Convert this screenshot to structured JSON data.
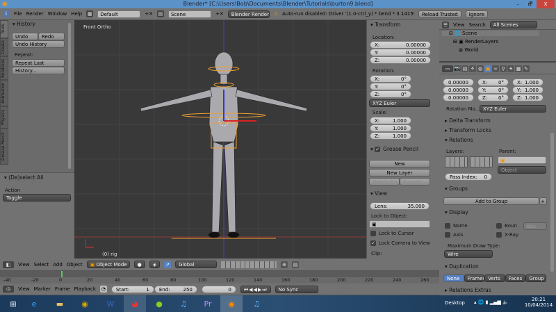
{
  "window": {
    "title": "Blender* [C:\\Users\\Bob\\Documents\\Blender\\Tutorials\\burton9.blend]",
    "minimize": "–",
    "maximize": "🗗",
    "close": "X"
  },
  "info_header": {
    "menus": [
      "File",
      "Render",
      "Window",
      "Help"
    ],
    "layout": "Default",
    "scene": "Scene",
    "engine": "Blender Render",
    "warning": "Auto-run disabled: Driver '(1.0-ctrl_y) * bend * 3.14159 * 2'",
    "reload": "Reload Trusted",
    "ignore": "Ignore"
  },
  "tool_shelf": {
    "tabs": [
      "Tools",
      "Create",
      "Relations",
      "Animation",
      "Physics",
      "Grease Pencil"
    ],
    "history_title": "History",
    "undo": "Undo",
    "redo": "Redo",
    "undo_history": "Undo History",
    "repeat_label": "Repeat:",
    "repeat_last": "Repeat Last",
    "history": "History...",
    "operator_title": "(De)select All",
    "action_label": "Action",
    "action_value": "Toggle"
  },
  "viewport": {
    "view_name": "Front Ortho",
    "object_label": "(0) rig"
  },
  "n_panel": {
    "transform_title": "Transform",
    "location_label": "Location:",
    "location": [
      "0.00000",
      "0.00000",
      "0.00000"
    ],
    "rotation_label": "Rotation:",
    "rotation": [
      "0°",
      "0°",
      "0°"
    ],
    "rotation_mode": "XYZ Euler",
    "scale_label": "Scale:",
    "scale": [
      "1.000",
      "1.000",
      "1.000"
    ],
    "axes": [
      "X:",
      "Y:",
      "Z:"
    ],
    "grease_title": "Grease Pencil",
    "new": "New",
    "new_layer": "New Layer",
    "delete_frame": "Delete Fra...",
    "convert": "Convert",
    "view_title": "View",
    "lens_label": "Lens:",
    "lens_value": "35.000",
    "lock_object_label": "Lock to Object:",
    "lock_cursor": "Lock to Cursor",
    "lock_camera": "Lock Camera to View",
    "clip_label": "Clip:"
  },
  "outliner": {
    "view": "View",
    "search": "Search",
    "filter": "All Scenes",
    "items": [
      "Scene",
      "RenderLayers",
      "World"
    ]
  },
  "properties": {
    "location": [
      "0.00000",
      "0.00000",
      "0.00000"
    ],
    "rotation": [
      "0°",
      "0°",
      "0°"
    ],
    "scale": [
      "1.000",
      "1.000",
      "1.000"
    ],
    "axes": [
      "X:",
      "Y:",
      "Z:"
    ],
    "rotation_mode_label": "Rotation Mo...",
    "rotation_mode": "XYZ Euler",
    "delta": "Delta Transform",
    "locks": "Transform Locks",
    "relations": "Relations",
    "layers_label": "Layers:",
    "parent_label": "Parent:",
    "parent_type": "Object",
    "pass_index_label": "Pass Index:",
    "pass_index": "0",
    "groups": "Groups",
    "add_to_group": "Add to Group",
    "display": "Display",
    "name": "Name",
    "axis": "Axis",
    "bounds": "Boun",
    "bounds_type": "Box",
    "xray": "X-Ray",
    "max_draw_label": "Maximum Draw Type:",
    "max_draw": "Wire",
    "duplication": "Duplication",
    "dup_options": [
      "None",
      "Frames",
      "Verts",
      "Faces",
      "Group"
    ],
    "relations_extras": "Relations Extras"
  },
  "view3d_header": {
    "menus": [
      "View",
      "Select",
      "Add",
      "Object"
    ],
    "mode": "Object Mode",
    "orientation": "Global"
  },
  "timeline": {
    "ticks": [
      "-40",
      "-20",
      "0",
      "20",
      "40",
      "60",
      "80",
      "100",
      "120",
      "140",
      "160",
      "180",
      "200",
      "220",
      "240",
      "260"
    ],
    "menus": [
      "View",
      "Marker",
      "Frame",
      "Playback"
    ],
    "start_label": "Start:",
    "start": "1",
    "end_label": "End:",
    "end": "250",
    "current": "0",
    "sync": "No Sync"
  },
  "taskbar": {
    "desktop": "Desktop",
    "time": "20:21",
    "date": "10/04/2014"
  },
  "colors": {
    "accent": "#5680c2",
    "viewport": "#393939",
    "orange": "#f0a030"
  }
}
